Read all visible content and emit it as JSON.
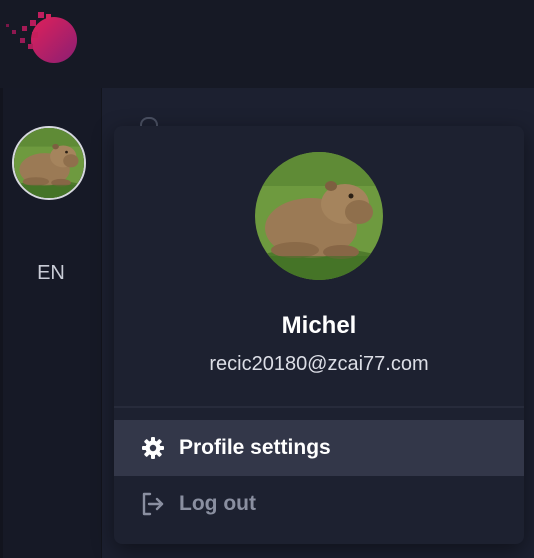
{
  "theme": {
    "background": "#1a1d2b",
    "popup_background": "#1d2130",
    "active_item_background": "#333749",
    "text_primary": "#ffffff",
    "text_muted": "#8a8fa0",
    "logo_colors": [
      "#e0205a",
      "#8a1f73"
    ]
  },
  "header": {
    "logo_icon": "brand-logo-icon"
  },
  "sidebar": {
    "avatar_alt": "capybara-avatar",
    "language": "EN"
  },
  "profile_menu": {
    "name": "Michel",
    "email": "recic20180@zcai77.com",
    "avatar_alt": "capybara-avatar",
    "items": [
      {
        "label": "Profile settings",
        "icon": "gear-icon"
      },
      {
        "label": "Log out",
        "icon": "logout-icon"
      }
    ]
  }
}
